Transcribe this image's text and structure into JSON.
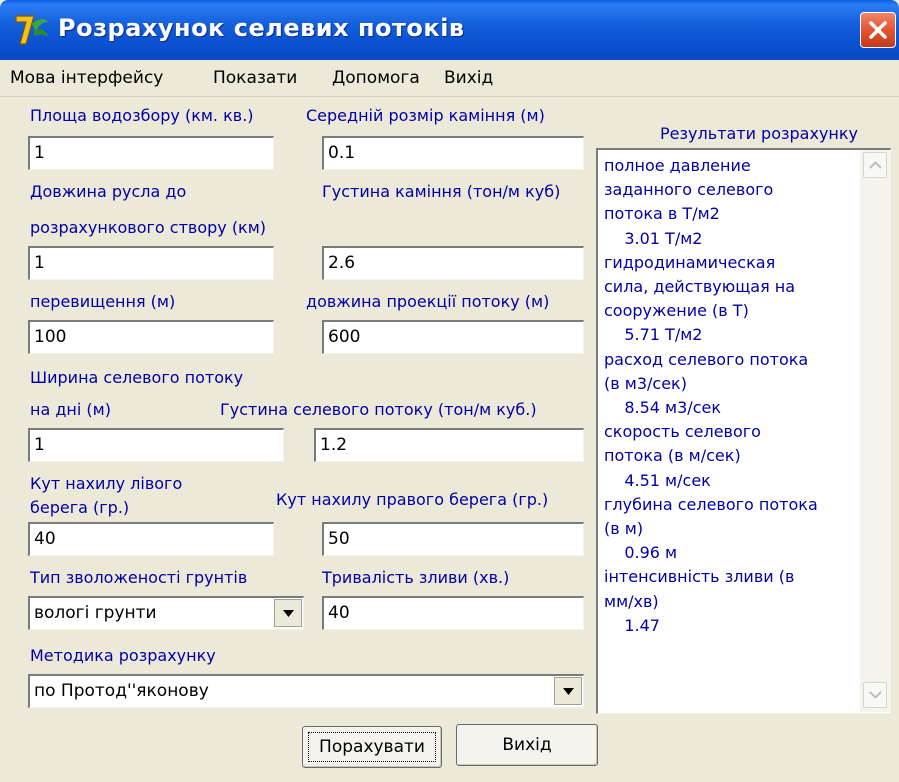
{
  "window": {
    "title": "Розрахунок селевих потоків",
    "icon": "app-logo-icon",
    "close_icon": "close-icon"
  },
  "menu": [
    "Мова інтерфейсу",
    "Показати",
    "Допомога",
    "Вихід"
  ],
  "form": {
    "area_label": "Площа водозбору (км. кв.)",
    "area_value": "1",
    "stone_size_label": "Середній розмір каміння (м)",
    "stone_size_value": "0.1",
    "channel_length_label_1": "Довжина русла до",
    "channel_length_label_2": "розрахункового створу (км)",
    "channel_length_value": "1",
    "stone_density_label": "Густина каміння  (тон/м куб)",
    "stone_density_value": "2.6",
    "elevation_label": "перевищення (м)",
    "elevation_value": "100",
    "projection_length_label": "довжина проекції потоку (м)",
    "projection_length_value": "600",
    "bottom_width_label_1": "Ширина селевого потоку",
    "bottom_width_label_2": "на дні (м)",
    "bottom_width_value": "1",
    "flow_density_label": "Густина селевого  потоку (тон/м куб.)",
    "flow_density_value": "1.2",
    "left_slope_label_1": "Кут нахилу лівого",
    "left_slope_label_2": "берега (гр.)",
    "left_slope_value": "40",
    "right_slope_label": "Кут нахилу правого  берега (гр.)",
    "right_slope_value": "50",
    "soil_type_label": "Тип зволоженості грунтів",
    "soil_type_value": "вологі грунти",
    "rain_duration_label": "Тривалість зливи (хв.)",
    "rain_duration_value": "40",
    "method_label": "Методика розрахунку",
    "method_value": "по Протод''яконову"
  },
  "results": {
    "title": "Результати розрахунку",
    "text": "полное давление\nзаданного селевого\nпотока в Т/м2\n    3.01 Т/м2\nгидродинамическая\nсила, действующая на\nсооружение (в Т)\n    5.71 Т/м2\nрасход селевого потока\n(в м3/сек)\n    8.54 м3/сек\nскорость селевого\nпотока (в м/сек)\n    4.51 м/сек\nглубина селевого потока\n(в м)\n    0.96 м\nінтенсивність зливи (в\nмм/хв)\n    1.47"
  },
  "buttons": {
    "calculate": "Порахувати",
    "exit": "Вихід"
  }
}
